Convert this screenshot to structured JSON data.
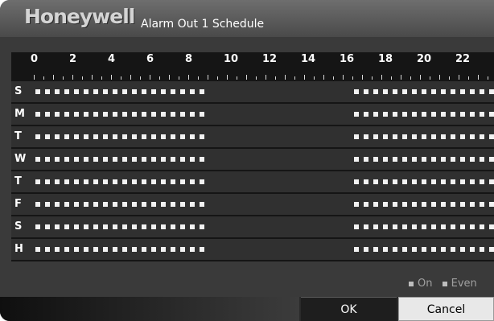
{
  "dialog": {
    "brand": "Honeywell",
    "title": "Alarm Out 1 Schedule"
  },
  "ruler": {
    "hour_labels": [
      "0",
      "2",
      "4",
      "6",
      "8",
      "10",
      "12",
      "14",
      "16",
      "18",
      "20",
      "22"
    ]
  },
  "schedule": {
    "rows": [
      {
        "label": "S",
        "on_ranges": [
          [
            0,
            8.75
          ],
          [
            16.5,
            24
          ]
        ]
      },
      {
        "label": "M",
        "on_ranges": [
          [
            0,
            8.75
          ],
          [
            16.5,
            24
          ]
        ]
      },
      {
        "label": "T",
        "on_ranges": [
          [
            0,
            8.75
          ],
          [
            16.5,
            24
          ]
        ]
      },
      {
        "label": "W",
        "on_ranges": [
          [
            0,
            8.75
          ],
          [
            16.5,
            24
          ]
        ]
      },
      {
        "label": "T",
        "on_ranges": [
          [
            0,
            8.75
          ],
          [
            16.5,
            24
          ]
        ]
      },
      {
        "label": "F",
        "on_ranges": [
          [
            0,
            8.75
          ],
          [
            16.5,
            24
          ]
        ]
      },
      {
        "label": "S",
        "on_ranges": [
          [
            0,
            8.75
          ],
          [
            16.5,
            24
          ]
        ]
      },
      {
        "label": "H",
        "on_ranges": [
          [
            0,
            8.75
          ],
          [
            16.5,
            24
          ]
        ]
      }
    ]
  },
  "legend": {
    "on": "On",
    "event": "Even"
  },
  "buttons": {
    "ok": "OK",
    "cancel": "Cancel"
  }
}
